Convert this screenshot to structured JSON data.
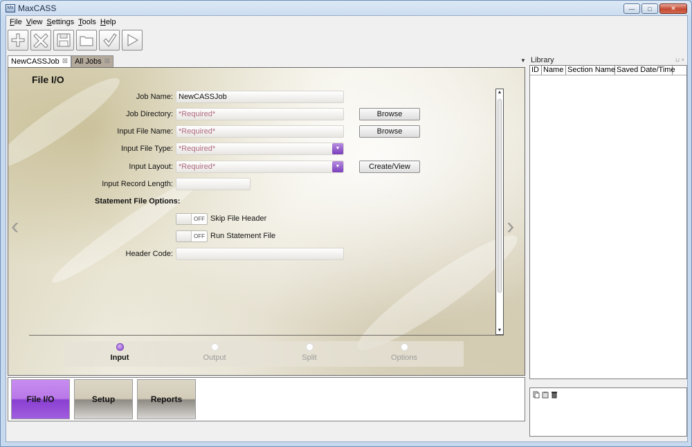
{
  "window": {
    "title": "MaxCASS",
    "app_icon_text": "Mx",
    "minimize_symbol": "—",
    "maximize_symbol": "□",
    "close_symbol": "✕"
  },
  "menu": [
    {
      "label": "File",
      "accel": "F",
      "rest": "ile"
    },
    {
      "label": "View",
      "accel": "V",
      "rest": "iew"
    },
    {
      "label": "Settings",
      "accel": "S",
      "rest": "ettings"
    },
    {
      "label": "Tools",
      "accel": "T",
      "rest": "ools"
    },
    {
      "label": "Help",
      "accel": "H",
      "rest": "elp"
    }
  ],
  "toolbar": {
    "icons": [
      "add-icon",
      "delete-icon",
      "save-icon",
      "open-folder-icon",
      "check-icon",
      "run-icon"
    ]
  },
  "tabs": [
    {
      "label": "NewCASSJob",
      "active": true
    },
    {
      "label": "All Jobs",
      "active": false
    }
  ],
  "tab_close_symbol": "⊠",
  "tab_menu_symbol": "▼",
  "editor": {
    "section_title": "File I/O",
    "job_name": {
      "label": "Job Name:",
      "value": "NewCASSJob"
    },
    "job_directory": {
      "label": "Job Directory:",
      "placeholder": "*Required*",
      "button": "Browse"
    },
    "input_file_name": {
      "label": "Input File Name:",
      "placeholder": "*Required*",
      "button": "Browse"
    },
    "input_file_type": {
      "label": "Input File Type:",
      "placeholder": "*Required*"
    },
    "input_layout": {
      "label": "Input Layout:",
      "placeholder": "*Required*",
      "button": "Create/View"
    },
    "input_record_length": {
      "label": "Input Record Length:",
      "value": ""
    },
    "statement_file_options": "Statement File Options:",
    "skip_file_header": {
      "state": "OFF",
      "label": "Skip File Header"
    },
    "run_statement_file": {
      "state": "OFF",
      "label": "Run Statement File"
    },
    "header_code": {
      "label": "Header Code:",
      "value": ""
    },
    "dropdown_symbol": "▼",
    "nav_prev": "‹",
    "nav_next": "›"
  },
  "steps": [
    {
      "label": "Input",
      "active": true
    },
    {
      "label": "Output",
      "active": false
    },
    {
      "label": "Split",
      "active": false
    },
    {
      "label": "Options",
      "active": false
    }
  ],
  "bottom_buttons": [
    {
      "label": "File I/O",
      "active": true
    },
    {
      "label": "Setup",
      "active": false
    },
    {
      "label": "Reports",
      "active": false
    }
  ],
  "library": {
    "title": "Library",
    "pin_symbol": "⊔ ×",
    "columns": [
      "ID",
      "Name",
      "Section Name",
      "Saved Date/Time"
    ],
    "tool_icons": [
      "copy-icon",
      "paste-icon",
      "trash-icon"
    ]
  },
  "colors": {
    "accent_purple": "#8a3fd0",
    "required_text": "#b06a80"
  }
}
